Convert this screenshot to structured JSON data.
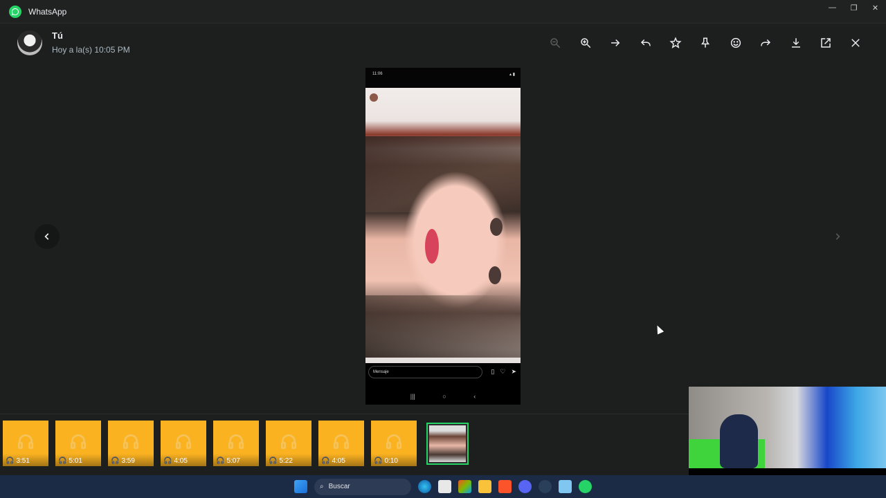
{
  "app": {
    "title": "WhatsApp"
  },
  "window_controls": {
    "minimize": "—",
    "restore": "❐",
    "close": "✕"
  },
  "header": {
    "sender": "Tú",
    "timestamp": "Hoy a la(s) 10:05 PM"
  },
  "toolbar": {
    "icons": [
      "zoom-out-icon",
      "zoom-in-icon",
      "go-to-message-icon",
      "reply-icon",
      "star-icon",
      "pin-icon",
      "emoji-react-icon",
      "forward-icon",
      "download-icon",
      "open-external-icon",
      "close-icon"
    ]
  },
  "viewer": {
    "status_time": "11:06",
    "message_placeholder": "Mensaje"
  },
  "thumbnails": [
    {
      "duration": "3:51"
    },
    {
      "duration": "5:01"
    },
    {
      "duration": "3:59"
    },
    {
      "duration": "4:05"
    },
    {
      "duration": "5:07"
    },
    {
      "duration": "5:22"
    },
    {
      "duration": "4:05"
    },
    {
      "duration": "0:10"
    }
  ],
  "taskbar": {
    "search_label": "Buscar"
  },
  "colors": {
    "accent": "#25d366",
    "audio_tile": "#fbb221",
    "background": "#1d1f1f"
  }
}
